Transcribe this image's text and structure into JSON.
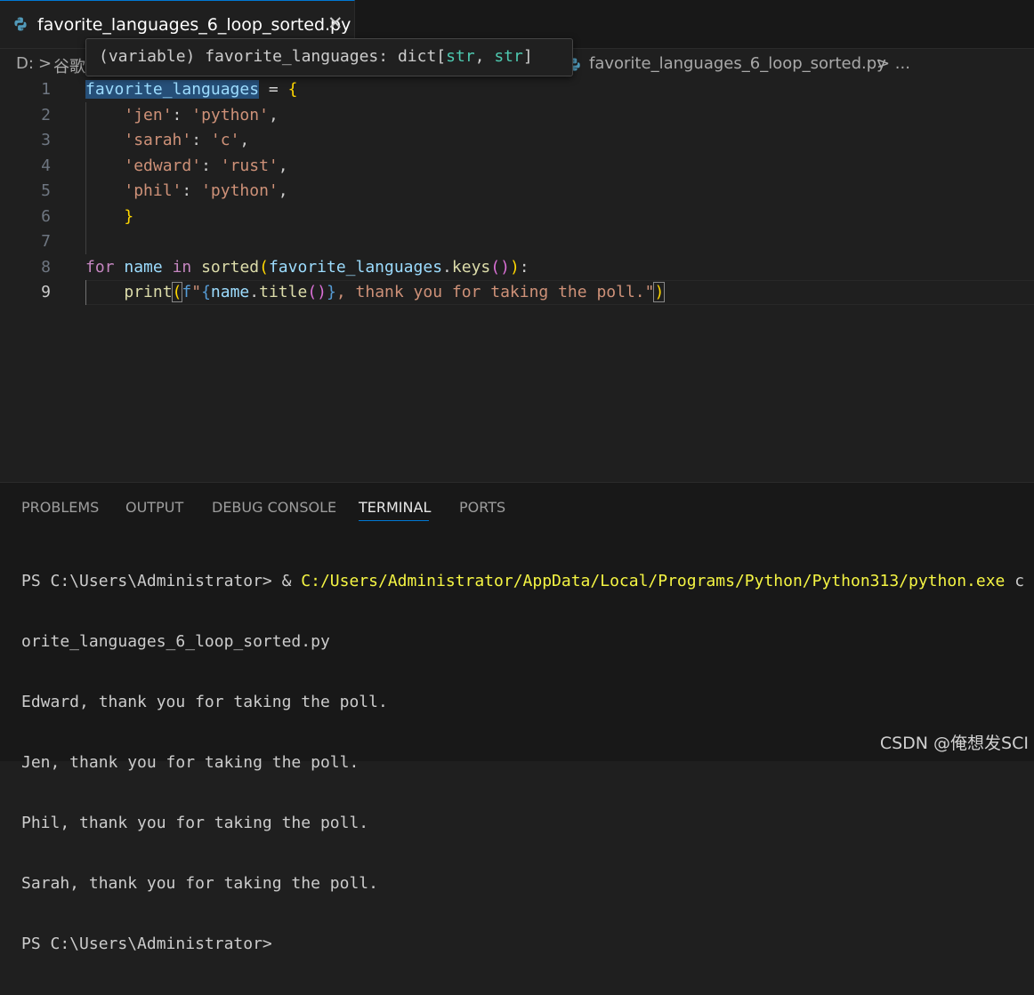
{
  "tab": {
    "title": "favorite_languages_6_loop_sorted.py",
    "close": "✕"
  },
  "breadcrumb": {
    "drive": "D:",
    "sep": ">",
    "folder1": "谷歌",
    "file": "favorite_languages_6_loop_sorted.py",
    "more": "> ..."
  },
  "hover": {
    "prefix": "(variable) favorite_languages: dict[",
    "type1": "str",
    "comma": ", ",
    "type2": "str",
    "suffix": "]"
  },
  "editor": {
    "line_numbers": [
      "1",
      "2",
      "3",
      "4",
      "5",
      "6",
      "7",
      "8",
      "9"
    ],
    "active_line": "9",
    "code": {
      "l1_var": "favorite_languages",
      "l1_op": " = ",
      "l1_br": "{",
      "l2_k": "'jen'",
      "l2_v": "'python'",
      "l3_k": "'sarah'",
      "l3_v": "'c'",
      "l4_k": "'edward'",
      "l4_v": "'rust'",
      "l5_k": "'phil'",
      "l5_v": "'python'",
      "colon": ": ",
      "comma": ",",
      "l6_br": "}",
      "l8_for": "for",
      "l8_name": "name",
      "l8_in": "in",
      "l8_sorted": "sorted",
      "l8_var": "favorite_languages",
      "l8_keys": "keys",
      "l9_print": "print",
      "l9_f": "f",
      "l9_str1": "\"",
      "l9_name": "name",
      "l9_title": "title",
      "l9_str2": ", thank you for taking the poll.\""
    }
  },
  "panel": {
    "tabs": [
      "PROBLEMS",
      "OUTPUT",
      "DEBUG CONSOLE",
      "TERMINAL",
      "PORTS"
    ],
    "active_tab": "TERMINAL",
    "terminal": {
      "prompt1": "PS C:\\Users\\Administrator> & ",
      "exe_path": "C:/Users/Administrator/AppData/Local/Programs/Python/Python313/python.exe",
      "exe_tail": " c",
      "line2": "orite_languages_6_loop_sorted.py",
      "out1": "Edward, thank you for taking the poll.",
      "out2": "Jen, thank you for taking the poll.",
      "out3": "Phil, thank you for taking the poll.",
      "out4": "Sarah, thank you for taking the poll.",
      "prompt2": "PS C:\\Users\\Administrator>"
    }
  },
  "watermark": "CSDN @俺想发SCI",
  "colors": {
    "accent": "#0078d4",
    "string": "#ce9178",
    "keyword": "#c586c0",
    "function": "#dcdcaa",
    "variable": "#9cdcfe",
    "path": "#f5f543"
  }
}
